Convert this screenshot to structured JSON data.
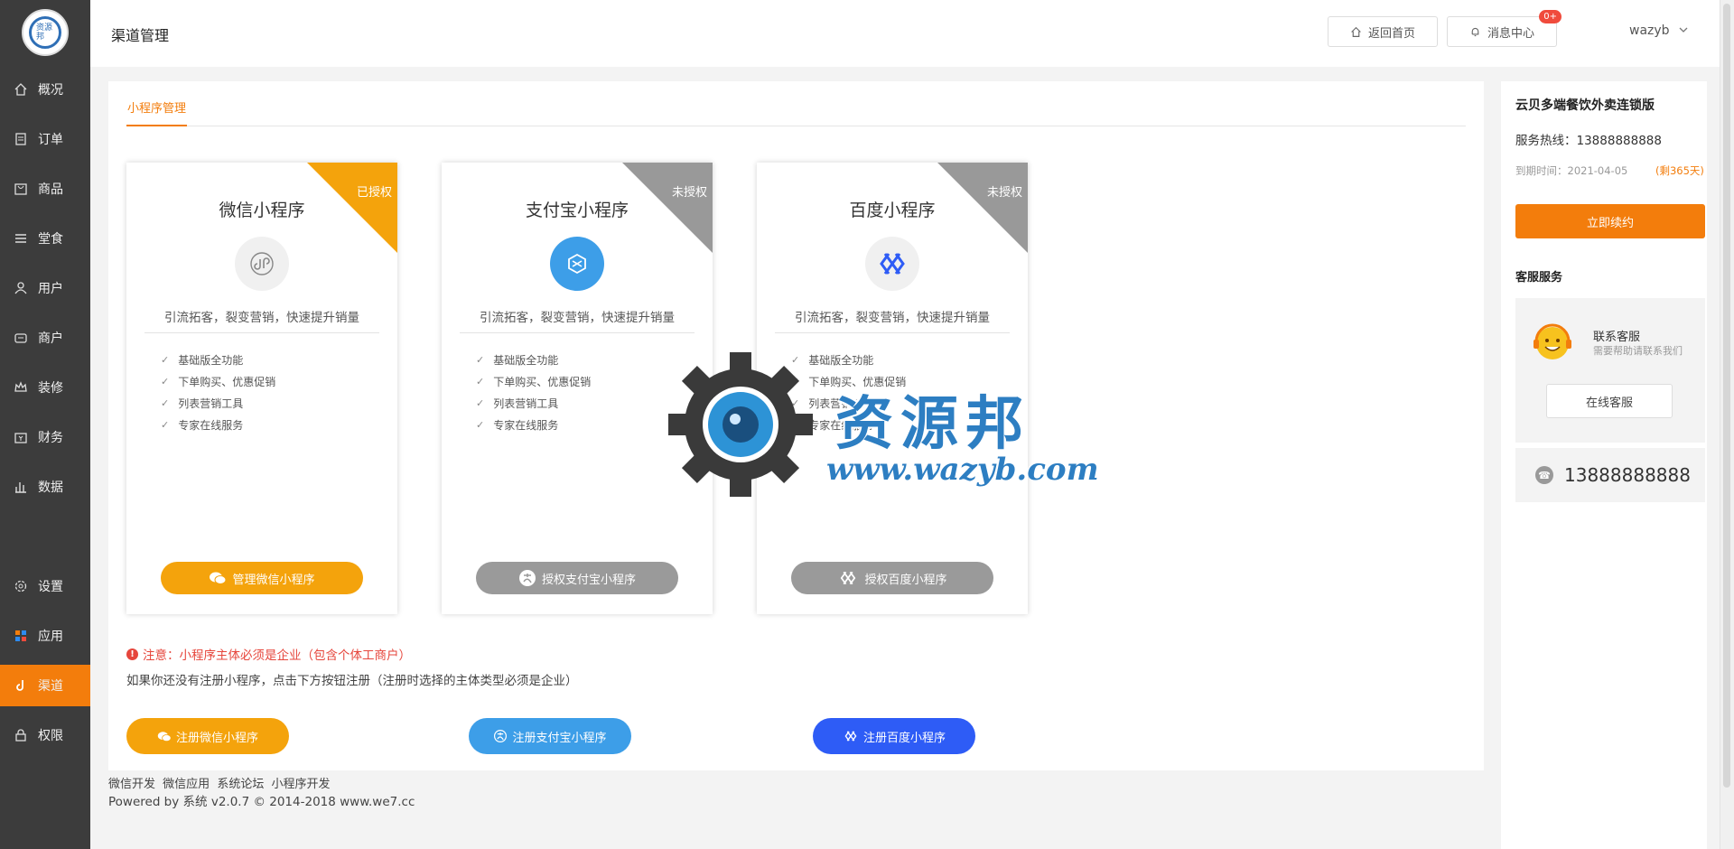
{
  "sidebar": {
    "logo_text": "资源邦",
    "items": [
      {
        "label": "概况",
        "icon": "home-icon"
      },
      {
        "label": "订单",
        "icon": "order-icon"
      },
      {
        "label": "商品",
        "icon": "bag-icon"
      },
      {
        "label": "堂食",
        "icon": "list-icon"
      },
      {
        "label": "用户",
        "icon": "user-icon"
      },
      {
        "label": "商户",
        "icon": "store-icon"
      },
      {
        "label": "装修",
        "icon": "crown-icon"
      },
      {
        "label": "财务",
        "icon": "wallet-icon"
      },
      {
        "label": "数据",
        "icon": "chart-icon"
      },
      {
        "label": "设置",
        "icon": "gear-icon"
      },
      {
        "label": "应用",
        "icon": "apps-icon"
      },
      {
        "label": "渠道",
        "icon": "channel-icon"
      },
      {
        "label": "权限",
        "icon": "lock-icon"
      }
    ],
    "active_index": 11
  },
  "header": {
    "title": "渠道管理",
    "home_button": "返回首页",
    "message_button": "消息中心",
    "message_badge": "0+",
    "username": "wazyb"
  },
  "main": {
    "tab": "小程序管理",
    "cards": [
      {
        "title": "微信小程序",
        "status": "已授权",
        "desc": "引流拓客，裂变营销，快速提升销量",
        "features": [
          "基础版全功能",
          "下单购买、优惠促销",
          "列表营销工具",
          "专家在线服务"
        ],
        "button": "管理微信小程序",
        "button_color": "#f4a30c"
      },
      {
        "title": "支付宝小程序",
        "status": "未授权",
        "desc": "引流拓客，裂变营销，快速提升销量",
        "features": [
          "基础版全功能",
          "下单购买、优惠促销",
          "列表营销工具",
          "专家在线服务"
        ],
        "button": "授权支付宝小程序",
        "button_color": "#9a9a9a"
      },
      {
        "title": "百度小程序",
        "status": "未授权",
        "desc": "引流拓客，裂变营销，快速提升销量",
        "features": [
          "基础版全功能",
          "下单购买、优惠促销",
          "列表营销工具",
          "专家在线服务"
        ],
        "button": "授权百度小程序",
        "button_color": "#9a9a9a"
      }
    ],
    "warning": "注意：小程序主体必须是企业（包含个体工商户）",
    "hint": "如果你还没有注册小程序，点击下方按钮注册（注册时选择的主体类型必须是企业）",
    "register_buttons": [
      {
        "label": "注册微信小程序",
        "color": "#f4a30c"
      },
      {
        "label": "注册支付宝小程序",
        "color": "#3d9ee8"
      },
      {
        "label": "注册百度小程序",
        "color": "#2e5cf6"
      }
    ]
  },
  "footer": {
    "links": [
      "微信开发",
      "微信应用",
      "系统论坛",
      "小程序开发"
    ],
    "powered": "Powered by 系统 v2.0.7 © 2014-2018 www.we7.cc"
  },
  "right_panel": {
    "product": "云贝多端餐饮外卖连锁版",
    "hotline": "服务热线：13888888888",
    "expire": "到期时间：2021-04-05",
    "remaining": "(剩365天)",
    "renew_button": "立即续约",
    "service_title": "客服服务",
    "cs_name": "联系客服",
    "cs_sub": "需要帮助请联系我们",
    "cs_button": "在线客服",
    "phone": "13888888888"
  },
  "watermark": {
    "title": "资源邦",
    "url": "www.wazyb.com"
  },
  "colors": {
    "accent": "#f37d0c",
    "sidebar": "#3c3c3c",
    "wechat": "#f4a30c",
    "alipay": "#3d9ee8",
    "baidu": "#2e5cf6"
  }
}
